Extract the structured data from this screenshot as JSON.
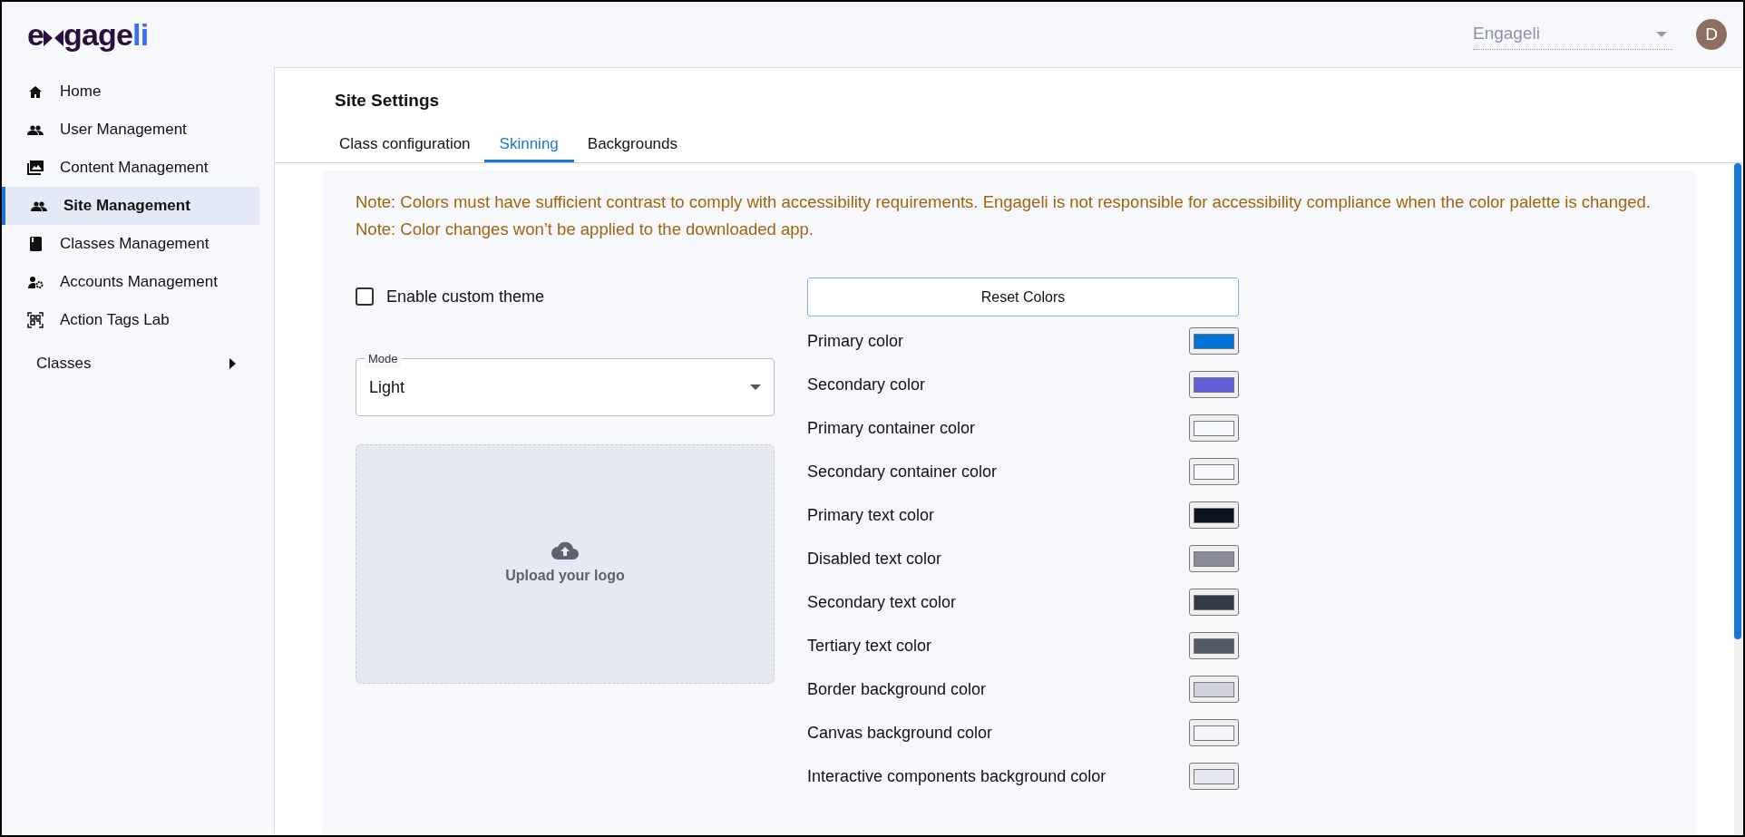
{
  "logo": {
    "start": "e",
    "middle": "gage",
    "end": "li"
  },
  "account_select": {
    "value": "Engageli"
  },
  "avatar": {
    "initial": "D"
  },
  "sidebar": {
    "items": [
      {
        "label": "Home",
        "kind": "home",
        "selected": false
      },
      {
        "label": "User Management",
        "kind": "people",
        "selected": false
      },
      {
        "label": "Content Management",
        "kind": "photos",
        "selected": false
      },
      {
        "label": "Site Management",
        "kind": "people",
        "selected": true
      },
      {
        "label": "Classes Management",
        "kind": "book",
        "selected": false
      },
      {
        "label": "Accounts Management",
        "kind": "accounts",
        "selected": false
      },
      {
        "label": "Action Tags Lab",
        "kind": "tags",
        "selected": false
      }
    ],
    "classes": {
      "label": "Classes",
      "expanded": false
    }
  },
  "page_title": "Site Settings",
  "tabs": [
    {
      "label": "Class configuration",
      "selected": false
    },
    {
      "label": "Skinning",
      "selected": true
    },
    {
      "label": "Backgrounds",
      "selected": false
    }
  ],
  "notes": [
    "Note: Colors must have sufficient contrast to comply with accessibility requirements. Engageli is not responsible for accessibility compliance when the color palette is changed.",
    "Note: Color changes won’t be applied to the downloaded app."
  ],
  "custom_theme": {
    "label": "Enable custom theme",
    "checked": false
  },
  "mode": {
    "label": "Mode",
    "value": "Light"
  },
  "upload": {
    "label": "Upload your logo"
  },
  "reset_button": "Reset Colors",
  "colors": [
    {
      "label": "Primary color",
      "color": "#0074d4"
    },
    {
      "label": "Secondary color",
      "color": "#635fd9"
    },
    {
      "label": "Primary container color",
      "color": "#f5f8fc"
    },
    {
      "label": "Secondary container color",
      "color": "#f9f8fd"
    },
    {
      "label": "Primary text color",
      "color": "#0d131f"
    },
    {
      "label": "Disabled text color",
      "color": "#878c98"
    },
    {
      "label": "Secondary text color",
      "color": "#343a46"
    },
    {
      "label": "Tertiary text color",
      "color": "#535a68"
    },
    {
      "label": "Border background color",
      "color": "#cdd2dc"
    },
    {
      "label": "Canvas background color",
      "color": "#f3f5f8"
    },
    {
      "label": "Interactive components background color",
      "color": "#e6e9f1"
    }
  ]
}
